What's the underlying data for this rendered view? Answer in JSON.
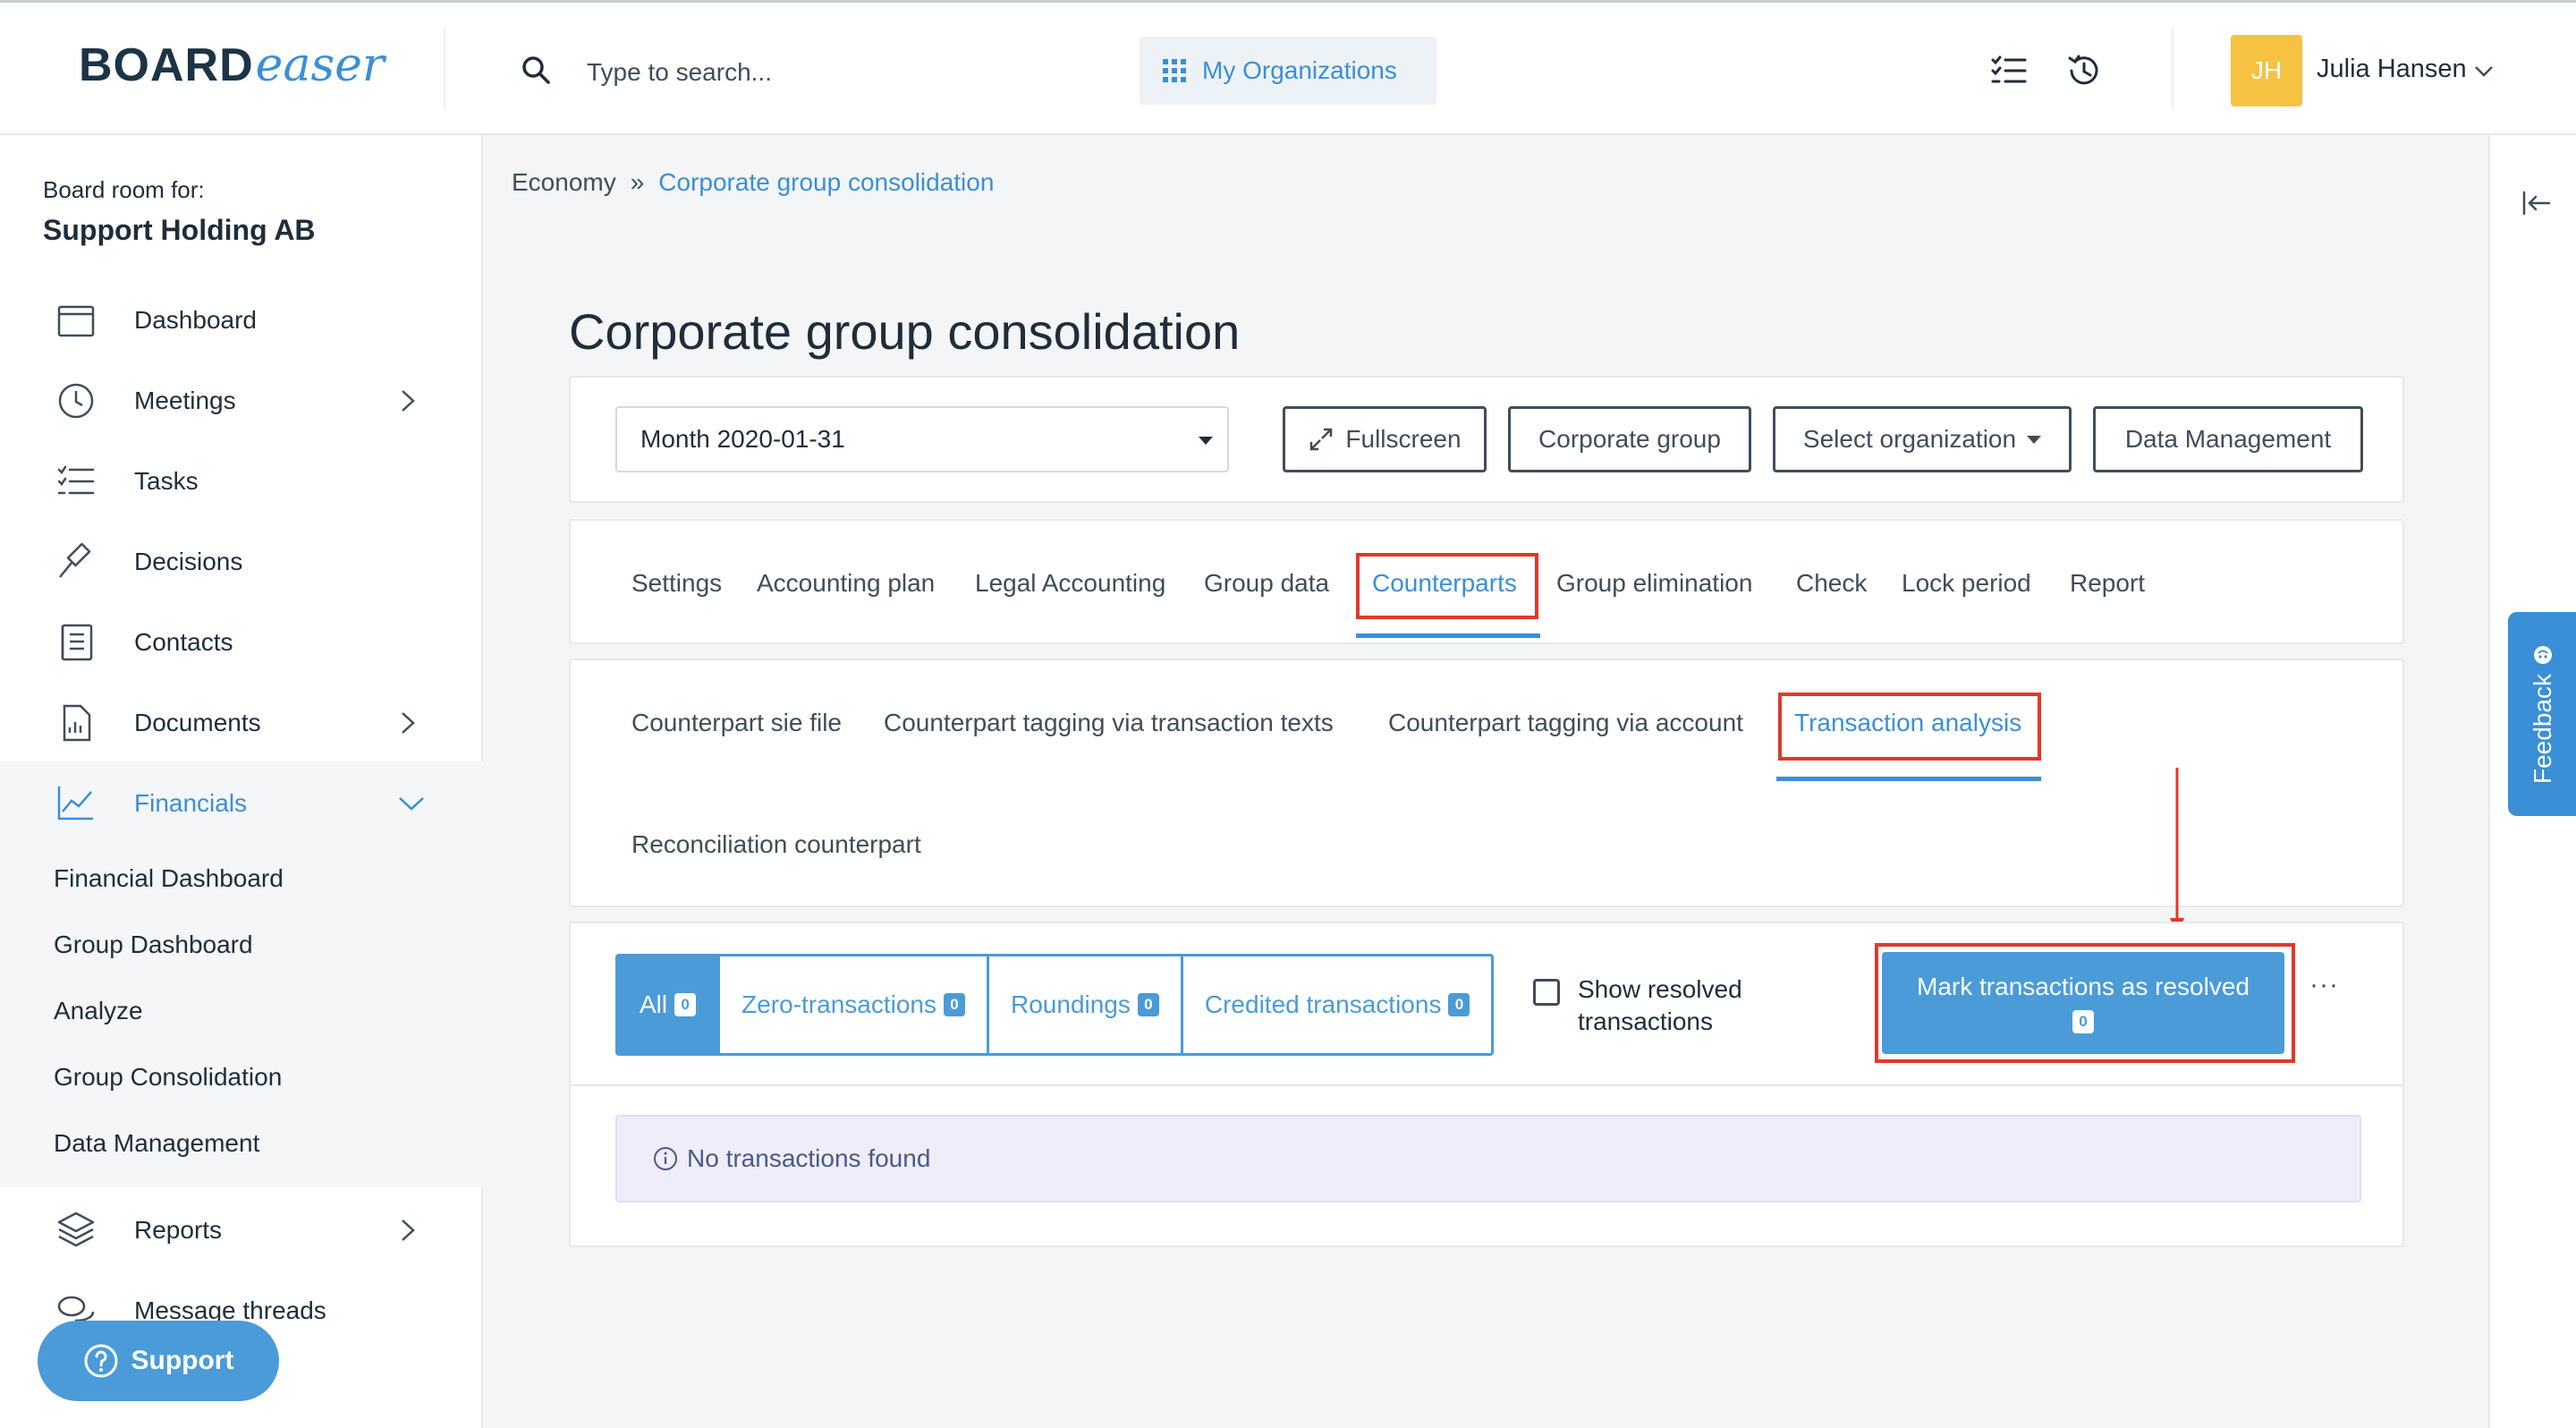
{
  "logo": {
    "board": "BOARD",
    "easer": "easer"
  },
  "search": {
    "placeholder": "Type to search..."
  },
  "header": {
    "org_button": "My Organizations",
    "user_initials": "JH",
    "user_name": "Julia Hansen"
  },
  "sidebar": {
    "caption": "Board room for:",
    "org_name": "Support Holding AB",
    "items": [
      {
        "label": "Dashboard",
        "icon": "calendar-icon"
      },
      {
        "label": "Meetings",
        "icon": "clock-icon"
      },
      {
        "label": "Tasks",
        "icon": "checklist-icon"
      },
      {
        "label": "Decisions",
        "icon": "gavel-icon"
      },
      {
        "label": "Contacts",
        "icon": "address-book-icon"
      },
      {
        "label": "Documents",
        "icon": "document-icon"
      },
      {
        "label": "Financials",
        "icon": "line-chart-icon"
      },
      {
        "label": "Reports",
        "icon": "layers-icon"
      },
      {
        "label": "Message threads",
        "icon": "chat-icon"
      }
    ],
    "financials_sub": [
      "Financial Dashboard",
      "Group Dashboard",
      "Analyze",
      "Group Consolidation",
      "Data Management"
    ],
    "support_label": "Support"
  },
  "feedback_label": "Feedback",
  "breadcrumb": {
    "parent": "Economy",
    "separator": "»",
    "current": "Corporate group consolidation"
  },
  "page_title": "Corporate group consolidation",
  "toolbar": {
    "month_select": "Month 2020-01-31",
    "fullscreen": "Fullscreen",
    "corporate_group": "Corporate group",
    "select_org": "Select organization",
    "data_management": "Data Management"
  },
  "main_tabs": [
    "Settings",
    "Accounting plan",
    "Legal Accounting",
    "Group data",
    "Counterparts",
    "Group elimination",
    "Check",
    "Lock period",
    "Report"
  ],
  "main_tab_active": "Counterparts",
  "sub_tabs": [
    "Counterpart sie file",
    "Counterpart tagging via transaction texts",
    "Counterpart tagging via account",
    "Transaction analysis",
    "Reconciliation counterpart"
  ],
  "sub_tab_active": "Transaction analysis",
  "filters": [
    {
      "label": "All",
      "count": "0"
    },
    {
      "label": "Zero-transactions",
      "count": "0"
    },
    {
      "label": "Roundings",
      "count": "0"
    },
    {
      "label": "Credited transactions",
      "count": "0"
    }
  ],
  "show_resolved_label": "Show resolved transactions",
  "mark_button": {
    "label": "Mark transactions as resolved",
    "count": "0"
  },
  "more_label": "···",
  "empty_message": "No transactions found",
  "colors": {
    "accent": "#3a8fd6",
    "button": "#4a9bd8",
    "highlight": "#e0392b",
    "avatar": "#f5c242"
  }
}
